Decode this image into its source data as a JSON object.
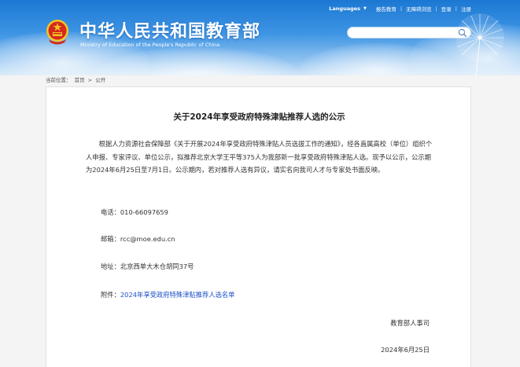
{
  "header": {
    "top_links": {
      "language": "Languages",
      "links": [
        "报告教育",
        "无障碍浏览",
        "登录",
        "注册"
      ]
    },
    "logo": {
      "name_cn": "中华人民共和国教育部",
      "name_en": "Ministry of Education of the People's Republic of China"
    },
    "search": {
      "placeholder": ""
    }
  },
  "breadcrumb": {
    "prefix": "当前位置：",
    "items": [
      "首页",
      "公开"
    ],
    "separator": ">"
  },
  "article": {
    "title": "关于2024年享受政府特殊津贴推荐人选的公示",
    "paragraph": "根据人力资源社会保障部《关于开展2024年享受政府特殊津贴人员选拔工作的通知》，经各直属高校（单位）组织个人申报、专家评议、单位公示，拟推荐北京大学王平等375人为我部新一批享受政府特殊津贴人选。现予以公示，公示期为2024年6月25日至7月1日。公示期内，若对推荐人选有异议，请实名向我司人才与专家处书面反映。",
    "phone": {
      "label": "电话：",
      "value": "010-66097659"
    },
    "email": {
      "label": "邮箱：",
      "value": "rcc@moe.edu.cn"
    },
    "address": {
      "label": "地址：",
      "value": "北京西单大木仓胡同37号"
    },
    "attachment": {
      "label": "附件：",
      "link_text": "2024年享受政府特殊津贴推荐人选名单"
    },
    "signature": {
      "org": "教育部人事司",
      "date": "2024年6月25日"
    }
  },
  "colors": {
    "header_blue": "#1b78d2",
    "link_blue": "#1a4fc7",
    "emblem_red": "#d42a1e",
    "emblem_gold": "#f3c623"
  }
}
